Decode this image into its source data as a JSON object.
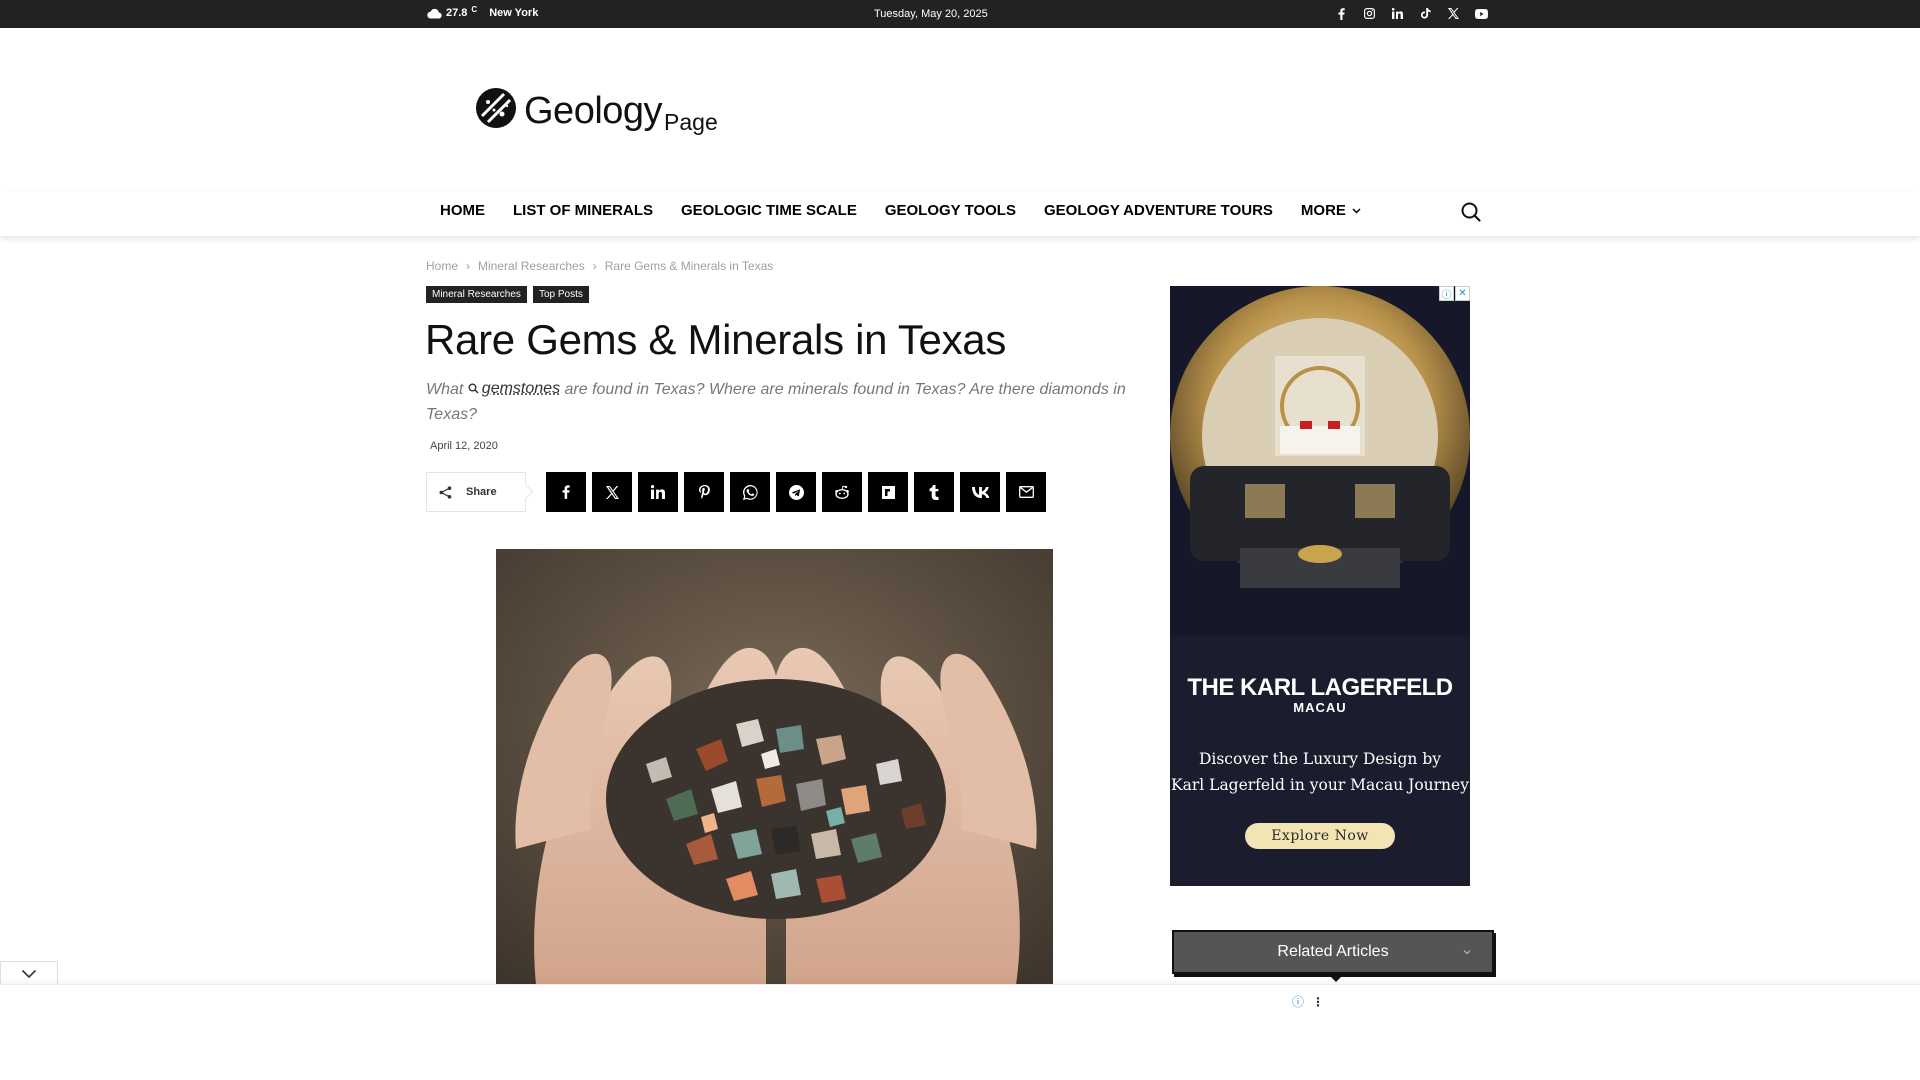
{
  "topbar": {
    "temperature": "27.8",
    "temperature_unit": "C",
    "city": "New York",
    "date": "Tuesday, May 20, 2025",
    "social_icons": [
      "facebook-icon",
      "instagram-icon",
      "linkedin-icon",
      "tiktok-icon",
      "x-icon",
      "youtube-icon"
    ]
  },
  "logo": {
    "word": "Geology",
    "sub": "Page"
  },
  "nav": {
    "items": [
      "HOME",
      "LIST OF MINERALS",
      "GEOLOGIC TIME SCALE",
      "GEOLOGY TOOLS",
      "GEOLOGY ADVENTURE TOURS",
      "MORE"
    ]
  },
  "breadcrumb": {
    "items": [
      "Home",
      "Mineral Researches",
      "Rare Gems & Minerals in Texas"
    ],
    "separator": "›"
  },
  "article": {
    "tags": [
      "Mineral Researches",
      "Top Posts"
    ],
    "title": "Rare Gems & Minerals in Texas",
    "subtitle_before": "What",
    "subtitle_keyword": "gemstones",
    "subtitle_after": "are found in Texas? Where are minerals found in Texas? Are there diamonds in Texas?",
    "date": "April 12, 2020",
    "share_label": "Share",
    "share_buttons": [
      "facebook",
      "x",
      "linkedin",
      "pinterest",
      "whatsapp",
      "telegram",
      "reddit",
      "flipboard",
      "tumblr",
      "vk",
      "email"
    ]
  },
  "ad": {
    "brand": "THE KARL LAGERFELD",
    "brand_sub": "MACAU",
    "copy_line1": "Discover the Luxury Design by",
    "copy_line2": "Karl Lagerfeld in your Macau Journey",
    "cta": "Explore Now"
  },
  "related": {
    "label": "Related Articles"
  },
  "colors": {
    "topbar": "#222222",
    "tag_bg": "#222222",
    "share_btn": "#000000",
    "ad_bg": "#1b1d2e",
    "ad_cta": "#f3e5b3",
    "related_bg": "#555555"
  }
}
